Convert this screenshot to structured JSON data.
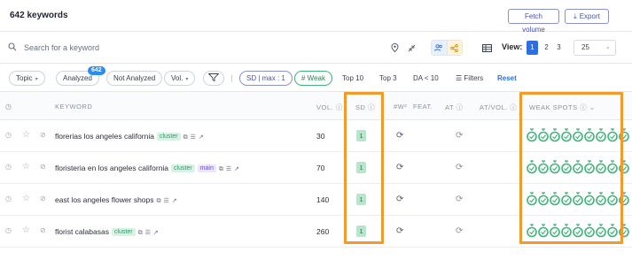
{
  "header": {
    "title": "642 keywords",
    "fetch_volume": "Fetch volume",
    "export": "Export"
  },
  "search": {
    "placeholder": "Search for a keyword"
  },
  "view": {
    "label": "View:",
    "pages": [
      "1",
      "2",
      "3"
    ],
    "active_page": "1",
    "page_size": "25"
  },
  "filters": {
    "topic": "Topic",
    "analyzed": "Analyzed",
    "analyzed_count": "642",
    "not_analyzed": "Not Analyzed",
    "vol": "Vol.",
    "sd": "SD | max : 1",
    "weak": "# Weak",
    "top10": "Top 10",
    "top3": "Top 3",
    "da": "DA < 10",
    "filters_label": "Filters",
    "reset": "Reset"
  },
  "table": {
    "headers": {
      "keyword": "KEYWORD",
      "vol": "VOL.",
      "sd": "SD",
      "w2": "#W²",
      "feat": "FEAT.",
      "at": "AT",
      "at_vol": "AT/VOL.",
      "weak_spots": "WEAK SPOTS"
    },
    "rows": [
      {
        "keyword": "florerias los angeles california",
        "tags": [
          "cluster"
        ],
        "vol": "30",
        "sd": "1"
      },
      {
        "keyword": "floristeria en los angeles california",
        "tags": [
          "cluster",
          "main"
        ],
        "vol": "70",
        "sd": "1"
      },
      {
        "keyword": "east los angeles flower shops",
        "tags": [],
        "vol": "140",
        "sd": "1"
      },
      {
        "keyword": "florist calabasas",
        "tags": [
          "cluster"
        ],
        "vol": "260",
        "sd": "1"
      }
    ]
  },
  "colors": {
    "accent": "#2d6fe0",
    "highlight": "#f39a2a",
    "weak_green": "#3fb37a"
  }
}
